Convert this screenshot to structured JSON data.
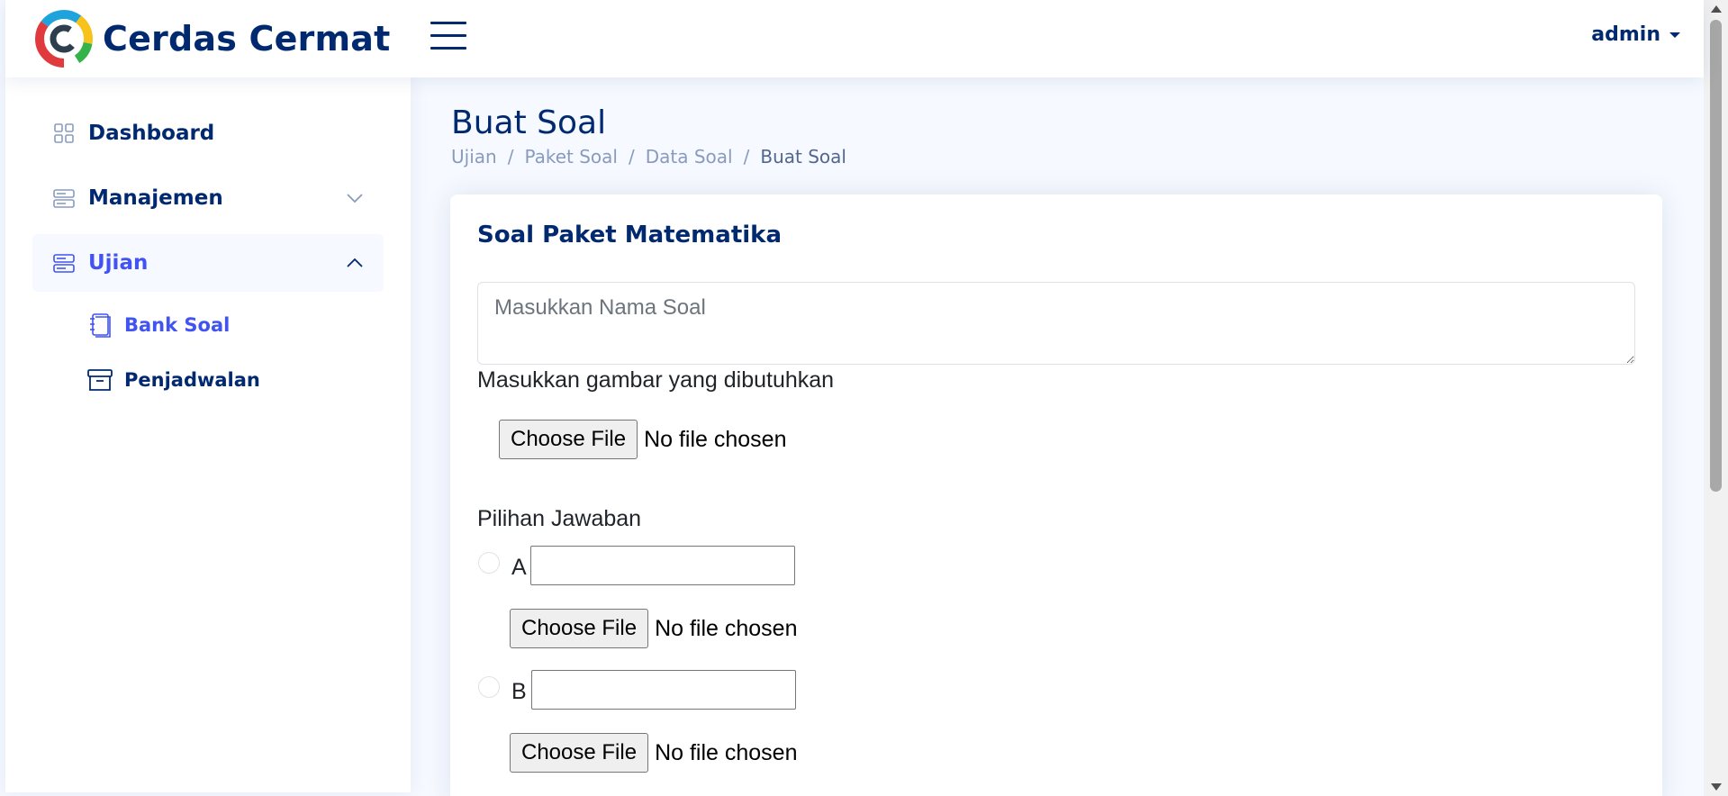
{
  "header": {
    "brand": "Cerdas Cermat",
    "user": "admin"
  },
  "sidebar": {
    "items": [
      {
        "label": "Dashboard",
        "icon": "grid-icon"
      },
      {
        "label": "Manajemen",
        "icon": "layout-icon",
        "expanded": false
      },
      {
        "label": "Ujian",
        "icon": "layout-icon",
        "expanded": true
      }
    ],
    "subitems": [
      {
        "label": "Bank Soal",
        "icon": "journals-icon"
      },
      {
        "label": "Penjadwalan",
        "icon": "archive-icon"
      }
    ]
  },
  "page": {
    "title": "Buat Soal",
    "breadcrumb": [
      "Ujian",
      "Paket Soal",
      "Data Soal",
      "Buat Soal"
    ]
  },
  "card": {
    "title": "Soal Paket Matematika",
    "soal_placeholder": "Masukkan Nama Soal",
    "image_label": "Masukkan gambar yang dibutuhkan",
    "file_button": "Choose File",
    "no_file": "No file chosen",
    "answers_label": "Pilihan Jawaban",
    "options": [
      {
        "letter": "A",
        "value": ""
      },
      {
        "letter": "B",
        "value": ""
      }
    ]
  },
  "colors": {
    "primary": "#012970",
    "accent": "#4154f1",
    "muted": "#899bbd",
    "background": "#f6f9ff"
  }
}
